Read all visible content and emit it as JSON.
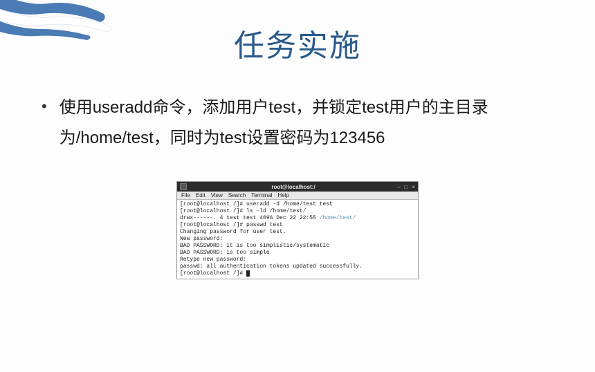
{
  "slide": {
    "title": "任务实施",
    "bullet_text": "使用useradd命令，添加用户test，并锁定test用户的主目录为/home/test，同时为test设置密码为123456"
  },
  "terminal": {
    "window_title": "root@localhost:/",
    "controls": {
      "min": "–",
      "max": "□",
      "close": "×"
    },
    "menu": {
      "file": "File",
      "edit": "Edit",
      "view": "View",
      "search": "Search",
      "terminal": "Terminal",
      "help": "Help"
    },
    "lines": {
      "l1": "[root@localhost /]# useradd -d /home/test test",
      "l2": "[root@localhost /]# ls -ld /home/test/",
      "l3a": "drwx------. 4 test test 4096 Dec 22 22:55 ",
      "l3b": "/home/test/",
      "l4": "[root@localhost /]# passwd test",
      "l5": "Changing password for user test.",
      "l6": "New password:",
      "l7": "BAD PASSWORD: it is too simplistic/systematic",
      "l8": "BAD PASSWORD: is too simple",
      "l9": "Retype new password:",
      "l10": "passwd: all authentication tokens updated successfully.",
      "l11": "[root@localhost /]# "
    }
  }
}
